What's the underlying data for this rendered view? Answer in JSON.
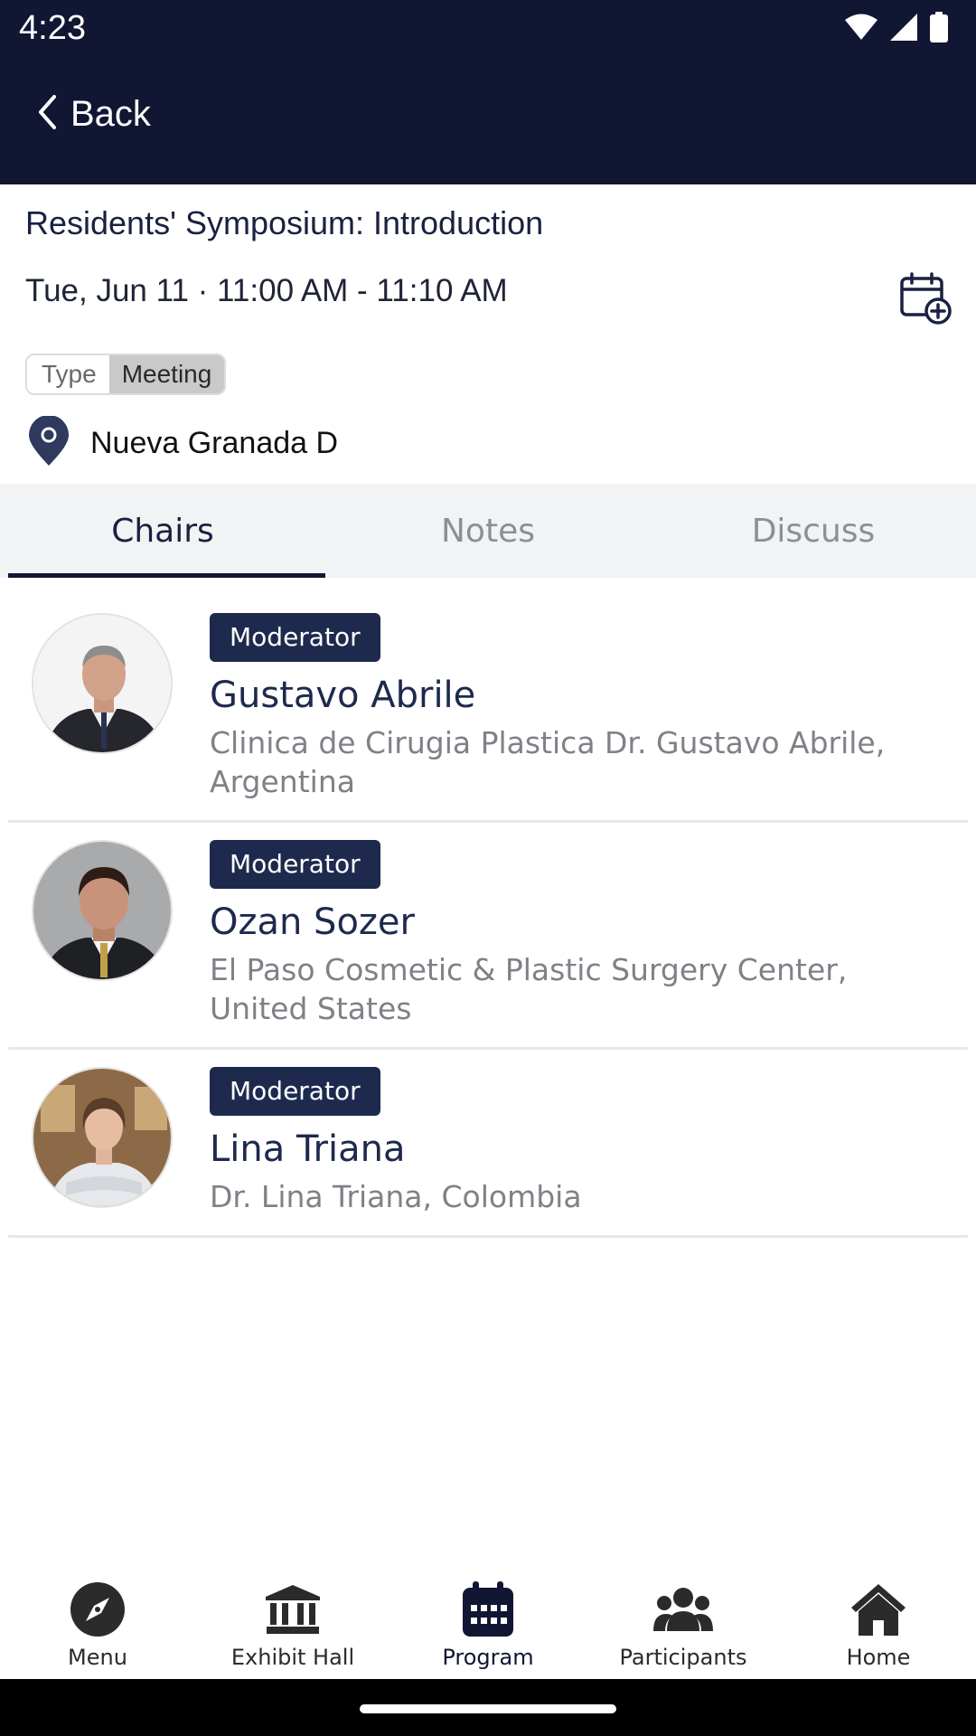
{
  "status_bar": {
    "time": "4:23"
  },
  "header": {
    "back_label": "Back"
  },
  "session": {
    "title": "Residents' Symposium: Introduction",
    "datetime": "Tue, Jun 11 · 11:00 AM - 11:10 AM",
    "type_label": "Type",
    "type_value": "Meeting",
    "location": "Nueva Granada D"
  },
  "tabs": [
    {
      "label": "Chairs",
      "active": true
    },
    {
      "label": "Notes",
      "active": false
    },
    {
      "label": "Discuss",
      "active": false
    }
  ],
  "chairs": [
    {
      "role": "Moderator",
      "name": "Gustavo Abrile",
      "affiliation": "Clinica de Cirugia Plastica Dr. Gustavo Abrile, Argentina"
    },
    {
      "role": "Moderator",
      "name": "Ozan Sozer",
      "affiliation": "El Paso Cosmetic & Plastic Surgery Center, United States"
    },
    {
      "role": "Moderator",
      "name": "Lina Triana",
      "affiliation": "Dr. Lina Triana, Colombia"
    }
  ],
  "bottom_nav": [
    {
      "label": "Menu",
      "icon": "compass-icon"
    },
    {
      "label": "Exhibit Hall",
      "icon": "building-columns-icon"
    },
    {
      "label": "Program",
      "icon": "calendar-icon",
      "active": true
    },
    {
      "label": "Participants",
      "icon": "people-icon"
    },
    {
      "label": "Home",
      "icon": "home-icon"
    }
  ],
  "colors": {
    "header_bg": "#111633",
    "badge_bg": "#1d2a4d",
    "tab_bar_bg": "#f2f3f5"
  }
}
